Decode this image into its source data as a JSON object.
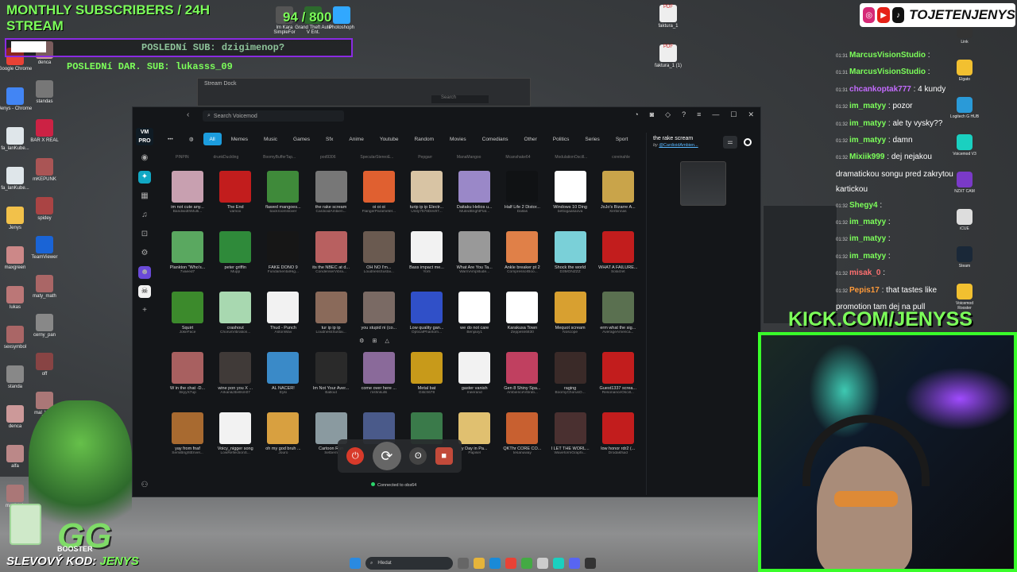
{
  "overlay": {
    "title_line1": "MONTHLY SUBSCRIBERS / 24H",
    "title_line2": "STREAM",
    "sub_count": "94 / 800",
    "last_sub": "POSLEDNí SUB: dzigimenop?",
    "last_dar": "POSLEDNí DAR. SUB: lukasss_09",
    "kick_url": "KICK.COM/JENYSS",
    "discount": "SLEVOVÝ KOD:",
    "discount_code": "JENYS",
    "handle": "TOJETENJENYS",
    "booster_text": "BOOSTER"
  },
  "desktop_icons_left": [
    {
      "label": "Google Chrome",
      "color": "#e94235"
    },
    {
      "label": "Jenys - Chrome",
      "color": "#4285f4"
    },
    {
      "label": "fa_lanKube...",
      "color": "#dfe6ea"
    },
    {
      "label": "fa_lanKube...",
      "color": "#dfe6ea"
    },
    {
      "label": "Jenys",
      "color": "#f2c14a"
    },
    {
      "label": "maxgreen",
      "color": "#c88"
    },
    {
      "label": "lukas",
      "color": "#b77"
    },
    {
      "label": "sexsymbol",
      "color": "#a66"
    },
    {
      "label": "standa",
      "color": "#888"
    },
    {
      "label": "denca",
      "color": "#c99"
    },
    {
      "label": "alfa",
      "color": "#b88"
    },
    {
      "label": "maslotek",
      "color": "#a77"
    }
  ],
  "desktop_icons_col2": [
    {
      "label": "denca",
      "color": "#c99"
    },
    {
      "label": "standas",
      "color": "#777"
    },
    {
      "label": "BAR X REAL",
      "color": "#c24"
    },
    {
      "label": "mKEPUNK",
      "color": "#a55"
    },
    {
      "label": "spidey",
      "color": "#a44"
    },
    {
      "label": "TeamViewer",
      "color": "#1a64d6"
    },
    {
      "label": "maty_math",
      "color": "#a66"
    },
    {
      "label": "cerny_pan",
      "color": "#888"
    },
    {
      "label": "off",
      "color": "#844"
    },
    {
      "label": "mal_karis",
      "color": "#a77"
    }
  ],
  "desktop_icons_top": [
    {
      "label": "lm Kara SimpleFor",
      "color": "#555"
    },
    {
      "label": "Grand Theft Auto V Ent.",
      "color": "#2d6a2d"
    },
    {
      "label": "Photoshoph",
      "color": "#31a8ff"
    },
    {
      "label": "faktura_1",
      "color": "#ddd"
    },
    {
      "label": "faktura_1 (1)",
      "color": "#ddd"
    }
  ],
  "chat": [
    {
      "time": "01:31",
      "user": "MarcusVisionStudio",
      "msg": ":",
      "style": "u"
    },
    {
      "time": "01:31",
      "user": "MarcusVisionStudio",
      "msg": ":",
      "style": "u"
    },
    {
      "time": "01:31",
      "user": "chcankoptak777",
      "msg": ": 4 kundy",
      "style": "u2"
    },
    {
      "time": "01:32",
      "user": "im_matyy",
      "msg": ": pozor",
      "style": "u"
    },
    {
      "time": "01:32",
      "user": "im_matyy",
      "msg": ": ale ty vysky??",
      "style": "u"
    },
    {
      "time": "01:32",
      "user": "im_matyy",
      "msg": ": damn",
      "style": "u"
    },
    {
      "time": "01:32",
      "user": "Mixiik999",
      "msg": ": dej nejakou",
      "style": "u"
    },
    {
      "time": "",
      "user": "",
      "msg": "dramatickou songu pred zakrytou",
      "style": ""
    },
    {
      "time": "",
      "user": "",
      "msg": "kartickou",
      "style": ""
    },
    {
      "time": "01:32",
      "user": "Shegy4",
      "msg": ":",
      "style": "u"
    },
    {
      "time": "01:32",
      "user": "im_matyy",
      "msg": ":",
      "style": "u"
    },
    {
      "time": "01:32",
      "user": "im_matyy",
      "msg": ":",
      "style": "u"
    },
    {
      "time": "01:32",
      "user": "im_matyy",
      "msg": ":",
      "style": "u"
    },
    {
      "time": "01:32",
      "user": "misak_0",
      "msg": ":",
      "style": "u3"
    },
    {
      "time": "01:32",
      "user": "Pepis17",
      "msg": ": that tastes like",
      "style": "u4"
    },
    {
      "time": "",
      "user": "",
      "msg": "promotion tam dej na pull",
      "style": ""
    }
  ],
  "stream_dock": {
    "title": "Stream Dock",
    "search": "Search"
  },
  "app": {
    "search_placeholder": "Search Voicemod",
    "logo": "VM PRO",
    "categories": [
      "All",
      "Memes",
      "Music",
      "Games",
      "Sfx",
      "Anime",
      "Youtube",
      "Random",
      "Movies",
      "Comedians",
      "Other",
      "Politics",
      "Series",
      "Sport"
    ],
    "top_authors": [
      "PINPIN",
      "drunkDuckling",
      "BoomyBufferTap...",
      "pod9306",
      "SpecularStereoE...",
      "Pepgarr",
      "ManaMangoo",
      "Mcanshake64",
      "ModulationOscill...",
      "cxreinahle"
    ],
    "sounds": [
      [
        {
          "name": "im not cute any...",
          "author": "BandwidthMulti...",
          "color": "#c8a0b0"
        },
        {
          "name": "The End",
          "author": "vamox",
          "color": "#c21d1d"
        },
        {
          "name": "flawed mangoes...",
          "author": "backroomslover",
          "color": "#3f8a3a"
        },
        {
          "name": "the rake scream",
          "author": "CardioidAmbien...",
          "color": "#777"
        },
        {
          "name": "oi oi oi",
          "author": "FlangerParameter...",
          "color": "#e06030"
        },
        {
          "name": "turip ip ip Electr...",
          "author": "Unity7576Dev97...",
          "color": "#d8c4a4"
        },
        {
          "name": "Daitaku Helios u...",
          "author": "MutedBrightFlat...",
          "color": "#9a88c8"
        },
        {
          "name": "Half Life 2 Distor...",
          "author": "Dallas",
          "color": "#101214"
        },
        {
          "name": "Windows 10 Ding",
          "author": "bettogaasaova",
          "color": "#ffffff"
        },
        {
          "name": "JoJo's Bizarre A...",
          "author": "Xerbinnas",
          "color": "#c9a44a"
        }
      ],
      [
        {
          "name": "Plankton \"Who's...",
          "author": "7vaeed7",
          "color": "#5aa860"
        },
        {
          "name": "peter griffin",
          "author": "Mupp",
          "color": "#2f8a3a"
        },
        {
          "name": "FAKE DONO 9",
          "author": "FundamentalHig...",
          "color": "#161616"
        },
        {
          "name": "its the NBEC at d...",
          "author": "CondenserVibra...",
          "color": "#b86060"
        },
        {
          "name": "OH NO I'm...",
          "author": "LoudnessSustai...",
          "color": "#6a5a50"
        },
        {
          "name": "Bass impact me...",
          "author": "Yorli",
          "color": "#f2f2f2"
        },
        {
          "name": "What Are You Ta...",
          "author": "WarmAmplitude...",
          "color": "#999"
        },
        {
          "name": "Ankle breaker pt 2",
          "author": "CompressorBoo...",
          "color": "#e08048"
        },
        {
          "name": "Shock the world",
          "author": "D3MONZZZ",
          "color": "#7ad0d8"
        },
        {
          "name": "WHAT A FAILURE...",
          "author": "Solarzet",
          "color": "#c21d1d"
        }
      ],
      [
        {
          "name": "Squirt",
          "author": "JokeFace",
          "color": "#3c8a2c"
        },
        {
          "name": "crashout",
          "author": "ChorusVibration...",
          "color": "#a8d8b0"
        },
        {
          "name": "Thud - Punch",
          "author": "AstonWav",
          "color": "#f2f2f2"
        },
        {
          "name": "tur ip ip ip",
          "author": "LoudnessSustai...",
          "color": "#8a6a5a"
        },
        {
          "name": "you stupid ni (co...",
          "author": "",
          "color": "#7a6a64"
        },
        {
          "name": "Low quality gan...",
          "author": "OpticalPhantom...",
          "color": "#3050c8"
        },
        {
          "name": "we do not care",
          "author": "Benjaxy1",
          "color": "#ffffff"
        },
        {
          "name": "Karakusa Town",
          "author": "Zeppelin6830",
          "color": "#ffffff"
        },
        {
          "name": "Mequot scream",
          "author": "Noscope",
          "color": "#d8a030"
        },
        {
          "name": "erm what the sig...",
          "author": "AverageAmerica...",
          "color": "#5a7050"
        }
      ],
      [
        {
          "name": "W in the chat -D...",
          "author": "SkyyX7up",
          "color": "#a86060"
        },
        {
          "name": "wine pon you X ...",
          "author": "Arkan&3bellsm07",
          "color": "#403a38"
        },
        {
          "name": "AL NACER!",
          "author": "Eyki",
          "color": "#3a8ac8"
        },
        {
          "name": "Im Not Your Aver...",
          "author": "Ballout",
          "color": "#2a2a2a"
        },
        {
          "name": "come over here ...",
          "author": "msfinkulls",
          "color": "#8a6a9a"
        },
        {
          "name": "Metal bat",
          "author": "Glitch678",
          "color": "#c89a1a"
        },
        {
          "name": "gaster vanish",
          "author": "meerand",
          "color": "#f2f2f2"
        },
        {
          "name": "Gen 8 Shiny Spa...",
          "author": "AmbienceVibrati...",
          "color": "#c04060"
        },
        {
          "name": "raging",
          "author": "BoomyChorusO...",
          "color": "#3a2a28"
        },
        {
          "name": "Guest1337 screa...",
          "author": "ResonanceOscill...",
          "color": "#c21d1d"
        }
      ],
      [
        {
          "name": "yay from fnaf",
          "author": "SemiBrightEnvel...",
          "color": "#a86a30"
        },
        {
          "name": "Voicy_nigger song",
          "author": "LowReflectionS...",
          "color": "#f2f2f2"
        },
        {
          "name": "oh my god bruh ...",
          "author": "Jouro",
          "color": "#d8a040"
        },
        {
          "name": "Cartoon Run",
          "author": "Setbern",
          "color": "#8a9aa0"
        },
        {
          "name": "",
          "author": "",
          "color": "#4a5a8a"
        },
        {
          "name": "",
          "author": "",
          "color": "#3a7a4a"
        },
        {
          "name": "y Day in Pa...",
          "author": "Papisel",
          "color": "#e0c070"
        },
        {
          "name": "QKThr CORE CO...",
          "author": "tesanuway",
          "color": "#c86030"
        },
        {
          "name": "I LET THE WORL...",
          "author": "WaveformGraphi...",
          "color": "#4a3030"
        },
        {
          "name": "low honor rdr2 (...",
          "author": "Drodakfluid",
          "color": "#c21d1d"
        }
      ]
    ],
    "selected_title": "the rake scream",
    "selected_by": "by",
    "selected_author": "@CardioidAmbien...",
    "connected": "Connected to obs64"
  },
  "taskbar": {
    "search": "Hledat"
  },
  "right_icons": [
    {
      "label": "Link",
      "color": "#333"
    },
    {
      "label": "Elgato",
      "color": "#f2c030"
    },
    {
      "label": "Logitech G HUB",
      "color": "#2a9ad8"
    },
    {
      "label": "Voicemod V3",
      "color": "#1ad0c0"
    },
    {
      "label": "NZXT CAM",
      "color": "#7a3ac8"
    },
    {
      "label": "iCUE",
      "color": "#ddd"
    },
    {
      "label": "Steam",
      "color": "#1a2838"
    },
    {
      "label": "Voicemod Rooster",
      "color": "#f2c030"
    }
  ]
}
